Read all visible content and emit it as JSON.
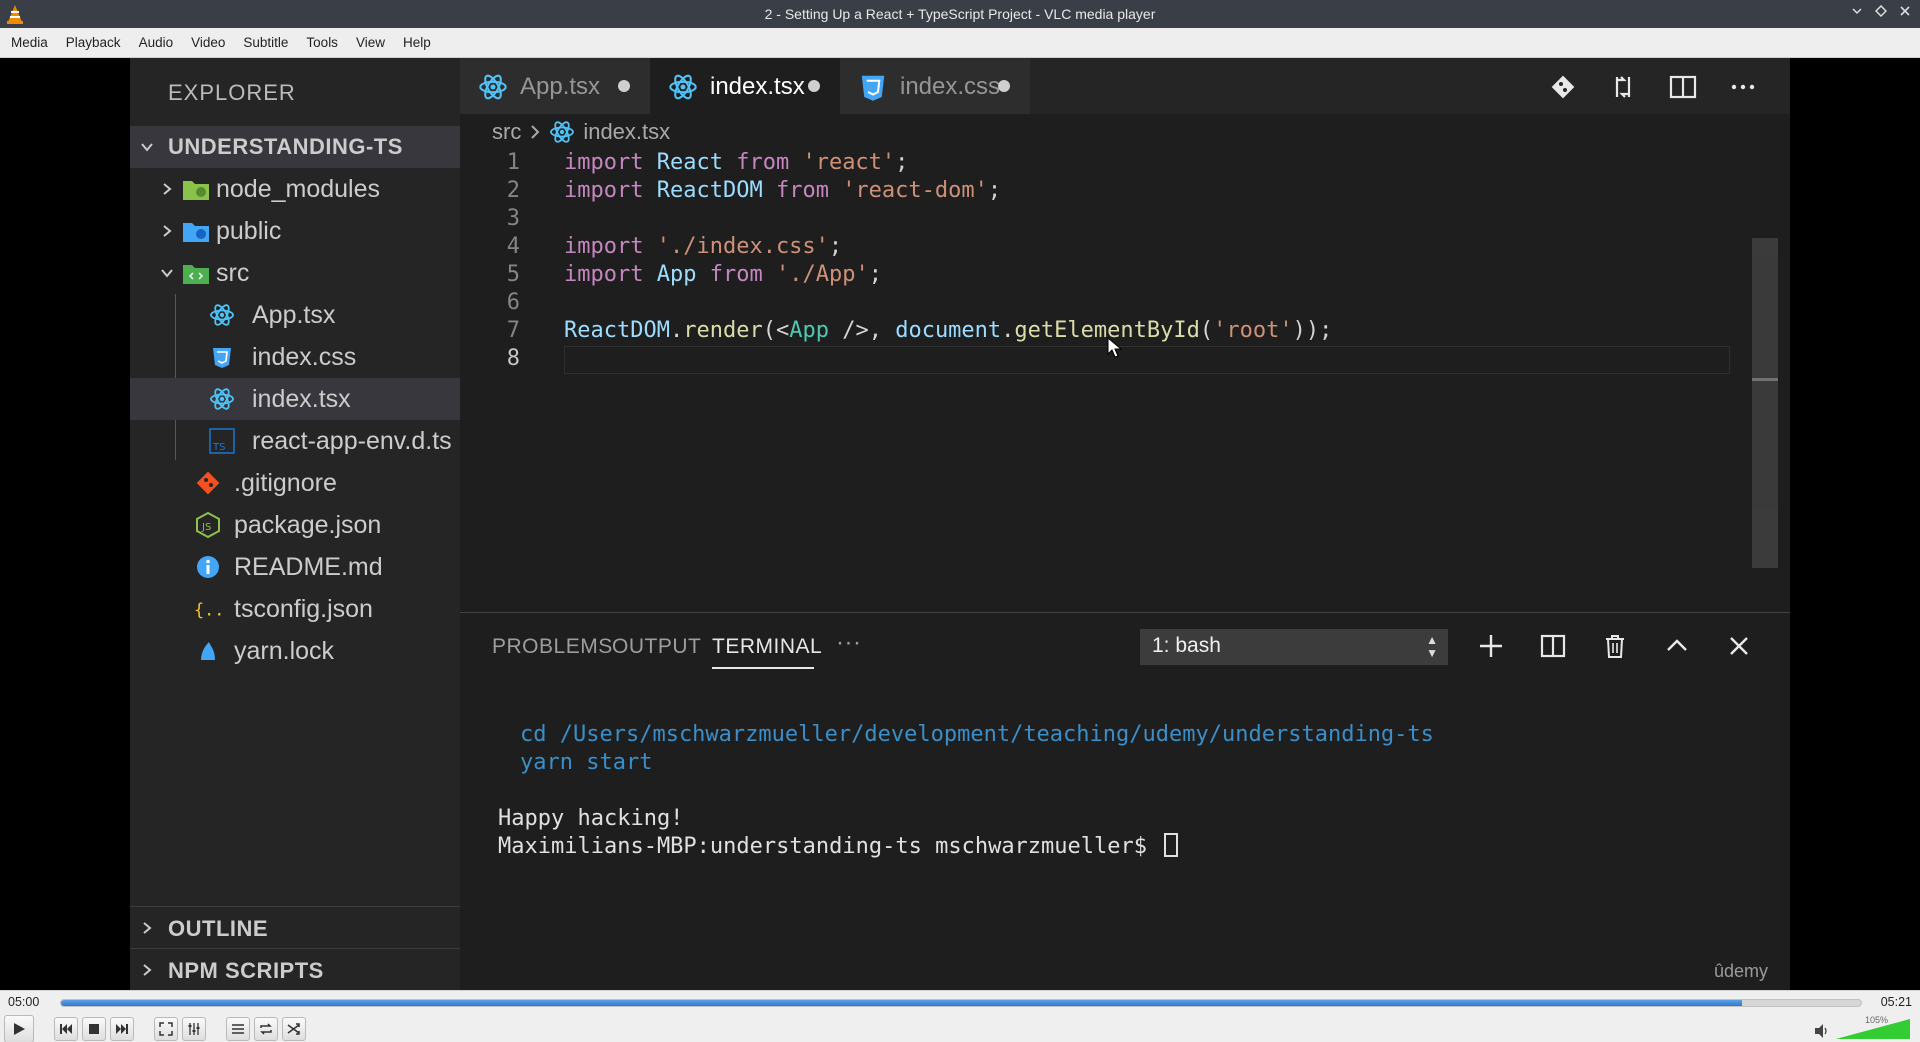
{
  "window": {
    "title": "2 - Setting Up a React + TypeScript Project - VLC media player"
  },
  "menubar": {
    "items": [
      "Media",
      "Playback",
      "Audio",
      "Video",
      "Subtitle",
      "Tools",
      "View",
      "Help"
    ]
  },
  "player": {
    "elapsed": "05:00",
    "total": "05:21",
    "progress_fraction": 0.934,
    "volume_label": "105%",
    "volume_fraction": 1.0,
    "colors": {
      "seek_fill": "#2f78c9",
      "volume": "#33cc33"
    }
  },
  "vscode": {
    "sidebar": {
      "title": "EXPLORER",
      "project": "UNDERSTANDING-TS",
      "tree": [
        {
          "label": "node_modules",
          "icon": "folder-node-icon"
        },
        {
          "label": "public",
          "icon": "folder-public-icon"
        },
        {
          "label": "src",
          "icon": "folder-src-icon"
        },
        {
          "label": "App.tsx",
          "icon": "react-icon"
        },
        {
          "label": "index.css",
          "icon": "css-icon"
        },
        {
          "label": "index.tsx",
          "icon": "react-icon"
        },
        {
          "label": "react-app-env.d.ts",
          "icon": "ts-icon"
        },
        {
          "label": ".gitignore",
          "icon": "git-icon"
        },
        {
          "label": "package.json",
          "icon": "nodejs-icon"
        },
        {
          "label": "README.md",
          "icon": "info-icon"
        },
        {
          "label": "tsconfig.json",
          "icon": "json-icon"
        },
        {
          "label": "yarn.lock",
          "icon": "yarn-icon"
        }
      ],
      "sections": [
        "OUTLINE",
        "NPM SCRIPTS"
      ]
    },
    "tabs": [
      {
        "label": "App.tsx",
        "active": false
      },
      {
        "label": "index.tsx",
        "active": true
      },
      {
        "label": "index.css",
        "active": false
      }
    ],
    "breadcrumb": {
      "folder": "src",
      "file": "index.tsx"
    },
    "code": {
      "line_numbers": [
        "1",
        "2",
        "3",
        "4",
        "5",
        "6",
        "7",
        "8"
      ],
      "lines": [
        "import React from 'react';",
        "import ReactDOM from 'react-dom';",
        "",
        "import './index.css';",
        "import App from './App';",
        "",
        "ReactDOM.render(<App />, document.getElementById('root'));",
        ""
      ],
      "tokens": {
        "import": "import",
        "from": "from",
        "React": "React",
        "ReactDOM": "ReactDOM",
        "App": "App",
        "react_str": "'react'",
        "react_dom_str": "'react-dom'",
        "index_css_str": "'./index.css'",
        "app_str": "'./App'",
        "render": "render",
        "document": "document",
        "getElementById": "getElementById",
        "root_str": "'root'",
        "semi": ";",
        "dot": ".",
        "open_paren": "(",
        "jsx_open": "<",
        "jsx_close": " />",
        "comma": ", ",
        "close": "));"
      }
    },
    "panel": {
      "tabs": [
        "PROBLEMS",
        "OUTPUT",
        "TERMINAL"
      ],
      "more": "···",
      "terminal_select": "1: bash",
      "terminal": {
        "cmd1": "cd /Users/mschwarzmueller/development/teaching/udemy/understanding-ts",
        "cmd2": "yarn start",
        "out1": "Happy hacking!",
        "prompt": "Maximilians-MBP:understanding-ts mschwarzmueller$ "
      },
      "watermark": "ûdemy"
    }
  }
}
